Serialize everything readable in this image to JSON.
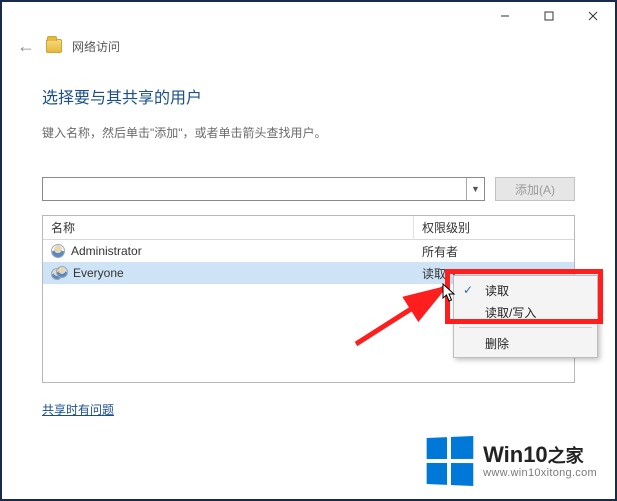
{
  "header": {
    "title": "网络访问"
  },
  "main": {
    "heading": "选择要与其共享的用户",
    "instruction": "键入名称，然后单击\"添加\"，或者单击箭头查找用户。",
    "input_value": "",
    "add_button": "添加(A)",
    "help_link": "共享时有问题"
  },
  "table": {
    "columns": [
      "名称",
      "权限级别"
    ],
    "rows": [
      {
        "name": "Administrator",
        "permission": "所有者"
      },
      {
        "name": "Everyone",
        "permission": "读取",
        "selected": true
      }
    ]
  },
  "menu": {
    "items": [
      "读取",
      "读取/写入",
      "删除"
    ],
    "checked_index": 0
  },
  "watermark": {
    "brand": "Win10",
    "suffix": "之家",
    "url": "www.win10xitong.com"
  },
  "annotation": {
    "highlight_color": "#ff1e1e"
  }
}
